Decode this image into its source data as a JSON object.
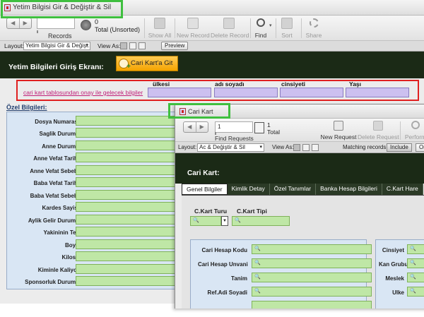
{
  "main_window": {
    "title": "Yetim Bilgisi Gir & Değiştir & Sil",
    "toolbar": {
      "record_value": "",
      "records_label": "Records",
      "count_value": "0",
      "total_label": "Total (Unsorted)",
      "buttons": [
        {
          "label": "Show All"
        },
        {
          "label": "New Record"
        },
        {
          "label": "Delete Record"
        },
        {
          "label": "Find"
        },
        {
          "label": "Sort"
        },
        {
          "label": "Share"
        }
      ]
    },
    "layoutbar": {
      "layout_label": "Layout:",
      "layout_value": "Yetim Bilgisi Gir & Değişt...",
      "view_label": "View As:",
      "preview_label": "Preview"
    },
    "header": {
      "title": "Yetim Bilgileri Giriş Ekranı:",
      "button_label": "Cari Kart'a Git"
    },
    "link_row": {
      "link_text": "cari kart tablosundan onay ile gelecek bilgiler",
      "columns": [
        "ülkesi",
        "adı soyadı",
        "cinsiyeti",
        "Yaşı"
      ]
    },
    "ozel": {
      "title": "Özel Bilgileri:",
      "fields": [
        "Dosya Numarasi",
        "Saglik Durumu",
        "Anne Durumu",
        "Anne Vefat Tarihi",
        "Anne Vefat Sebebi",
        "Baba Vefat Tarihi",
        "Baba Vefat Sebebi",
        "Kardes Sayisi",
        "Aylik Gelir Durumu",
        "Yakininin Teli",
        "Boyu",
        "Kilosu",
        "Kiminle Kaliyor",
        "Sponsorluk Durumu"
      ]
    }
  },
  "popup": {
    "title": "Cari Kart",
    "toolbar": {
      "record_value": "1",
      "find_requests_label": "Find Requests",
      "count_value": "1",
      "total_label": "Total",
      "new_request_label": "New Request",
      "delete_request_label": "Delete Request",
      "perform_label": "Perform"
    },
    "layoutbar": {
      "layout_label": "Layout:",
      "layout_value": "Ac & Değiştir & Sil",
      "view_label": "View As:",
      "matching_label": "Matching records:",
      "include_label": "Include",
      "omit_label": "Om"
    },
    "header_title": "Cari Kart:",
    "tabs": [
      "Genel Bilgiler",
      "Kimlik Detay",
      "Özel Tanımlar",
      "Banka Hesap Bilgileri",
      "C.Kart Hare"
    ],
    "genel": {
      "type_label": "C.Kart Turu",
      "tip_label": "C.Kart Tipi",
      "left_fields": [
        "Cari Hesap Kodu",
        "Cari Hesap Unvani",
        "Tanim",
        "Ref.Adi Soyadi"
      ],
      "right_fields": [
        "Cinsiyet",
        "Kan Grubu",
        "Meslek",
        "Ulke"
      ]
    }
  }
}
